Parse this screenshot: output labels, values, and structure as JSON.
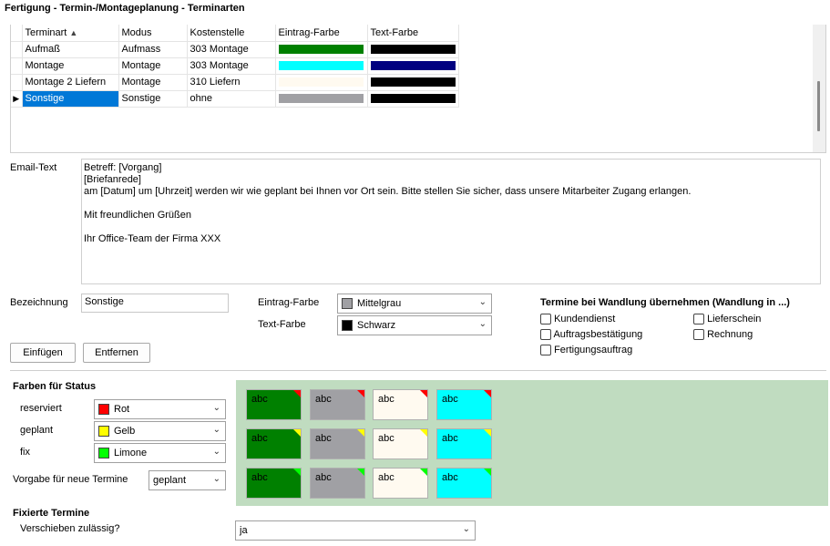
{
  "title": "Fertigung - Termin-/Montageplanung - Terminarten",
  "grid": {
    "columns": [
      "Terminart",
      "Modus",
      "Kostenstelle",
      "Eintrag-Farbe",
      "Text-Farbe"
    ],
    "sort_indicator": "▲",
    "rows": [
      {
        "terminart": "Aufmaß",
        "modus": "Aufmass",
        "kostenstelle": "303 Montage",
        "eintrag": "#008000",
        "text": "#000000"
      },
      {
        "terminart": "Montage",
        "modus": "Montage",
        "kostenstelle": "303 Montage",
        "eintrag": "#00ffff",
        "text": "#000080"
      },
      {
        "terminart": "Montage 2 Liefern",
        "modus": "Montage",
        "kostenstelle": "310 Liefern",
        "eintrag": "#fffaf0",
        "text": "#000000"
      },
      {
        "terminart": "Sonstige",
        "modus": "Sonstige",
        "kostenstelle": "ohne",
        "eintrag": "#a0a0a4",
        "text": "#000000"
      }
    ],
    "row_pointer": "▶"
  },
  "email": {
    "label": "Email-Text",
    "lines": [
      "Betreff: [Vorgang]",
      "[Briefanrede]",
      "am [Datum] um [Uhrzeit] werden wir wie geplant bei Ihnen vor Ort sein. Bitte stellen Sie sicher, dass unsere Mitarbeiter Zugang erlangen.",
      "",
      "Mit freundlichen Grüßen",
      "",
      "Ihr Office-Team der Firma XXX"
    ]
  },
  "form": {
    "bezeichnung_label": "Bezeichnung",
    "bezeichnung_value": "Sonstige",
    "eintrag_label": "Eintrag-Farbe",
    "eintrag_value": "Mittelgrau",
    "eintrag_color": "#a0a0a4",
    "text_label": "Text-Farbe",
    "text_value": "Schwarz",
    "text_color": "#000000",
    "add_button": "Einfügen",
    "remove_button": "Entfernen"
  },
  "wandlung": {
    "title": "Termine bei Wandlung übernehmen (Wandlung in ...)",
    "kundendienst": "Kundendienst",
    "lieferschein": "Lieferschein",
    "auftragsbestaetigung": "Auftragsbestätigung",
    "rechnung": "Rechnung",
    "fertigungsauftrag": "Fertigungsauftrag"
  },
  "status": {
    "title": "Farben für Status",
    "reserviert_label": "reserviert",
    "reserviert_value": "Rot",
    "reserviert_color": "#ff0000",
    "geplant_label": "geplant",
    "geplant_value": "Gelb",
    "geplant_color": "#ffff00",
    "fix_label": "fix",
    "fix_value": "Limone",
    "fix_color": "#00ff00",
    "vorgabe_label": "Vorgabe für neue Termine",
    "vorgabe_value": "geplant"
  },
  "preview": {
    "text": "abc",
    "tile_colors": [
      "#008000",
      "#a0a0a4",
      "#fffaf0",
      "#00ffff"
    ],
    "corner_colors": [
      "#ff0000",
      "#ffff00",
      "#00ff00"
    ],
    "background": "#c0dcc0"
  },
  "fixiert": {
    "title": "Fixierte Termine",
    "verschieben_label": "Verschieben zulässig?",
    "verschieben_value": "ja"
  }
}
